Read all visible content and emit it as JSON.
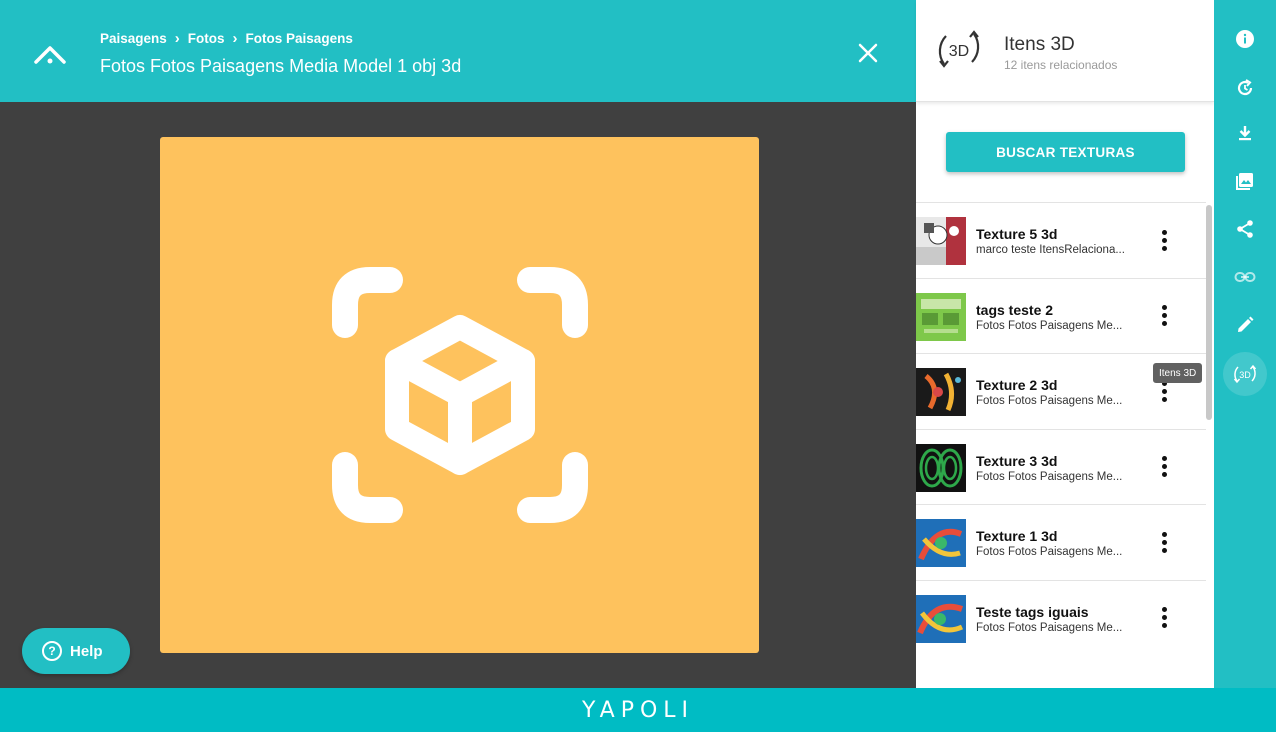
{
  "header": {
    "breadcrumb": [
      "Paisagens",
      "Fotos",
      "Fotos Paisagens"
    ],
    "title": "Fotos Fotos Paisagens Media Model 1 obj 3d"
  },
  "help": {
    "label": "Help"
  },
  "footer": {
    "brand": "YAPOLI"
  },
  "panel": {
    "icon_label": "3D",
    "title": "Itens 3D",
    "subtitle": "12 itens relacionados",
    "search_button": "BUSCAR TEXTURAS",
    "items": [
      {
        "title": "Texture 5 3d",
        "subtitle": "marco teste ItensRelaciona..."
      },
      {
        "title": "tags teste 2",
        "subtitle": "Fotos Fotos Paisagens Me..."
      },
      {
        "title": "Texture 2 3d",
        "subtitle": "Fotos Fotos Paisagens Me..."
      },
      {
        "title": "Texture 3 3d",
        "subtitle": "Fotos Fotos Paisagens Me..."
      },
      {
        "title": "Texture 1 3d",
        "subtitle": "Fotos Fotos Paisagens Me..."
      },
      {
        "title": "Teste tags iguais",
        "subtitle": "Fotos Fotos Paisagens Me..."
      }
    ]
  },
  "tooltip": {
    "text": "Itens 3D"
  },
  "sidebar": {
    "icons": [
      "info-icon",
      "history-icon",
      "download-icon",
      "gallery-icon",
      "share-icon",
      "link-icon",
      "edit-icon",
      "3d-icon"
    ],
    "active_icon_label": "3D"
  },
  "colors": {
    "teal": "#22bfc4",
    "viewer_bg": "#404040",
    "preview_bg": "#fec25d",
    "footer": "#00bcc4"
  }
}
